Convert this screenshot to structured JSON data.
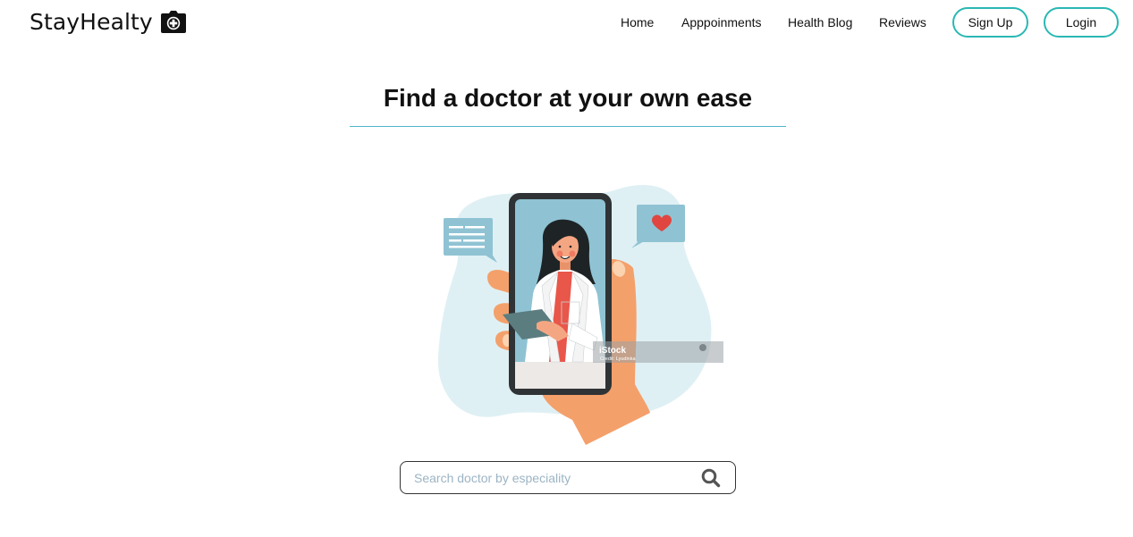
{
  "brand": {
    "name": "StayHealty",
    "logo_icon": "medical-bag-icon"
  },
  "nav": {
    "items": [
      {
        "label": "Home"
      },
      {
        "label": "Apppoinments"
      },
      {
        "label": "Health Blog"
      },
      {
        "label": "Reviews"
      }
    ],
    "signup_label": "Sign Up",
    "login_label": "Login"
  },
  "hero": {
    "title": "Find a doctor at your own ease",
    "illustration": {
      "watermark_brand": "iStock",
      "watermark_credit": "Credit: Lyudinka"
    }
  },
  "search": {
    "placeholder": "Search doctor by especiality",
    "value": "",
    "icon": "search-icon"
  },
  "colors": {
    "accent": "#2ab8b3",
    "divider": "#4fb6cf",
    "blob": "#dff0f4",
    "skin": "#f4a06b",
    "phone": "#2f3335"
  }
}
